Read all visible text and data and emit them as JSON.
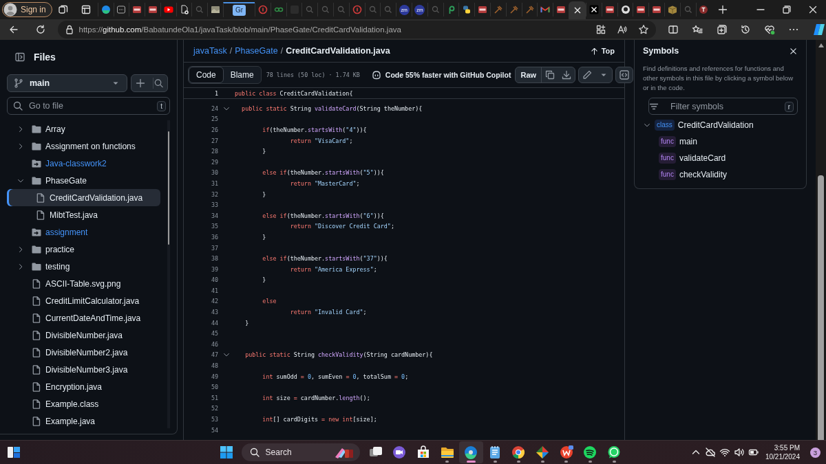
{
  "browser": {
    "profile": {
      "label": "Sign in"
    },
    "tabs": [
      {
        "kind": "edge",
        "selected": false
      },
      {
        "kind": "window",
        "selected": false
      },
      {
        "kind": "pdf",
        "selected": false
      },
      {
        "kind": "pdf",
        "selected": false
      },
      {
        "kind": "youtube",
        "selected": false
      },
      {
        "kind": "file",
        "selected": false
      },
      {
        "kind": "search",
        "selected": false
      },
      {
        "kind": "image",
        "selected": false
      },
      {
        "kind": "text",
        "label": "Gr",
        "selected": false
      },
      {
        "kind": "redring",
        "selected": false
      },
      {
        "kind": "gfg",
        "selected": false
      },
      {
        "kind": "dark",
        "selected": false
      },
      {
        "kind": "search",
        "selected": false
      },
      {
        "kind": "search",
        "selected": false
      },
      {
        "kind": "search",
        "selected": false
      },
      {
        "kind": "redring",
        "selected": false
      },
      {
        "kind": "search",
        "selected": false
      },
      {
        "kind": "search",
        "selected": false
      },
      {
        "kind": "zoom",
        "label": "zm",
        "selected": false
      },
      {
        "kind": "zoom",
        "label": "zm",
        "selected": false
      },
      {
        "kind": "search",
        "selected": false
      },
      {
        "kind": "p",
        "selected": false
      },
      {
        "kind": "python",
        "selected": false
      },
      {
        "kind": "pdf",
        "selected": false
      },
      {
        "kind": "pen",
        "selected": false
      },
      {
        "kind": "pen",
        "selected": false
      },
      {
        "kind": "pen",
        "selected": false
      },
      {
        "kind": "gmail",
        "selected": false
      },
      {
        "kind": "pdf",
        "selected": false
      },
      {
        "kind": "blank",
        "selected": true
      },
      {
        "kind": "x",
        "selected": false
      },
      {
        "kind": "pdf",
        "selected": false
      },
      {
        "kind": "github",
        "selected": false
      },
      {
        "kind": "pdf",
        "selected": false
      },
      {
        "kind": "pdf",
        "selected": false
      },
      {
        "kind": "box",
        "selected": false
      },
      {
        "kind": "search",
        "selected": false
      },
      {
        "kind": "redt",
        "selected": false
      }
    ],
    "address": {
      "url": "https://github.com/BabatundeOla1/javaTask/blob/main/PhaseGate/CreditCardValidation.java"
    }
  },
  "sidebar": {
    "title": "Files",
    "branch": "main",
    "search": {
      "placeholder": "Go to file",
      "shortcut": "t"
    },
    "tree": [
      {
        "kind": "folder",
        "name": "Array",
        "expanded": false,
        "selected": false
      },
      {
        "kind": "folder",
        "name": "Assignment on functions",
        "expanded": false,
        "selected": false
      },
      {
        "kind": "submodule",
        "name": "Java-classwork2",
        "selected": false
      },
      {
        "kind": "folder",
        "name": "PhaseGate",
        "expanded": true,
        "selected": false,
        "children": [
          {
            "kind": "file",
            "name": "CreditCardValidation.java",
            "selected": true
          },
          {
            "kind": "file",
            "name": "MibtTest.java",
            "selected": false
          }
        ]
      },
      {
        "kind": "submodule",
        "name": "assignment",
        "selected": false
      },
      {
        "kind": "folder",
        "name": "practice",
        "expanded": false,
        "selected": false
      },
      {
        "kind": "folder",
        "name": "testing",
        "expanded": false,
        "selected": false
      },
      {
        "kind": "file",
        "name": "ASCII-Table.svg.png",
        "selected": false
      },
      {
        "kind": "file",
        "name": "CreditLimitCalculator.java",
        "selected": false
      },
      {
        "kind": "file",
        "name": "CurrentDateAndTime.java",
        "selected": false
      },
      {
        "kind": "file",
        "name": "DivisibleNumber.java",
        "selected": false
      },
      {
        "kind": "file",
        "name": "DivisibleNumber2.java",
        "selected": false
      },
      {
        "kind": "file",
        "name": "DivisibleNumber3.java",
        "selected": false
      },
      {
        "kind": "file",
        "name": "Encryption.java",
        "selected": false
      },
      {
        "kind": "file",
        "name": "Example.class",
        "selected": false
      },
      {
        "kind": "file",
        "name": "Example.java",
        "selected": false
      }
    ]
  },
  "file_header": {
    "breadcrumb": [
      {
        "kind": "link",
        "text": "javaTask"
      },
      {
        "kind": "separator",
        "text": "/"
      },
      {
        "kind": "link",
        "text": "PhaseGate"
      },
      {
        "kind": "separator",
        "text": "/"
      },
      {
        "kind": "current",
        "text": "CreditCardValidation.java"
      }
    ],
    "top": "Top"
  },
  "toolbar": {
    "tabs": [
      {
        "label": "Code",
        "selected": true
      },
      {
        "label": "Blame",
        "selected": false
      }
    ],
    "info": "78 lines (50 loc) · 1.74 KB",
    "promo": "Code 55% faster with GitHub Copilot",
    "raw": "Raw"
  },
  "code": {
    "sticky": {
      "number": "1",
      "tokens": [
        {
          "kind": "kw",
          "text": "public class "
        },
        {
          "kind": "p",
          "text": "CreditCardValidation{"
        }
      ]
    },
    "lines": [
      {
        "number": "24",
        "foldable": true,
        "tokens": [
          {
            "kind": "kw",
            "text": "  public static "
          },
          {
            "kind": "p",
            "text": "String "
          },
          {
            "kind": "fn",
            "text": "validateCard"
          },
          {
            "kind": "p",
            "text": "(String theNumber){"
          }
        ]
      },
      {
        "number": "25",
        "foldable": false
      },
      {
        "number": "26",
        "foldable": false,
        "tokens": [
          {
            "kind": "kw",
            "text": "        if"
          },
          {
            "kind": "p",
            "text": "(theNumber."
          },
          {
            "kind": "fn",
            "text": "startsWith"
          },
          {
            "kind": "p",
            "text": "("
          },
          {
            "kind": "str",
            "text": "\"4\""
          },
          {
            "kind": "p",
            "text": ")){"
          }
        ]
      },
      {
        "number": "27",
        "foldable": false,
        "tokens": [
          {
            "kind": "kw",
            "text": "                return "
          },
          {
            "kind": "str",
            "text": "\"VisaCard\""
          },
          {
            "kind": "p",
            "text": ";"
          }
        ]
      },
      {
        "number": "28",
        "foldable": false,
        "tokens": [
          {
            "kind": "p",
            "text": "        }"
          }
        ]
      },
      {
        "number": "29",
        "foldable": false
      },
      {
        "number": "30",
        "foldable": false,
        "tokens": [
          {
            "kind": "kw",
            "text": "        else if"
          },
          {
            "kind": "p",
            "text": "(theNumber."
          },
          {
            "kind": "fn",
            "text": "startsWith"
          },
          {
            "kind": "p",
            "text": "("
          },
          {
            "kind": "str",
            "text": "\"5\""
          },
          {
            "kind": "p",
            "text": ")){"
          }
        ]
      },
      {
        "number": "31",
        "foldable": false,
        "tokens": [
          {
            "kind": "kw",
            "text": "                return "
          },
          {
            "kind": "str",
            "text": "\"MasterCard\""
          },
          {
            "kind": "p",
            "text": ";"
          }
        ]
      },
      {
        "number": "32",
        "foldable": false,
        "tokens": [
          {
            "kind": "p",
            "text": "        }"
          }
        ]
      },
      {
        "number": "33",
        "foldable": false
      },
      {
        "number": "34",
        "foldable": false,
        "tokens": [
          {
            "kind": "kw",
            "text": "        else if"
          },
          {
            "kind": "p",
            "text": "(theNumber."
          },
          {
            "kind": "fn",
            "text": "startsWith"
          },
          {
            "kind": "p",
            "text": "("
          },
          {
            "kind": "str",
            "text": "\"6\""
          },
          {
            "kind": "p",
            "text": ")){"
          }
        ]
      },
      {
        "number": "35",
        "foldable": false,
        "tokens": [
          {
            "kind": "kw",
            "text": "                return "
          },
          {
            "kind": "str",
            "text": "\"Discover Credit Card\""
          },
          {
            "kind": "p",
            "text": ";"
          }
        ]
      },
      {
        "number": "36",
        "foldable": false,
        "tokens": [
          {
            "kind": "p",
            "text": "        }"
          }
        ]
      },
      {
        "number": "37",
        "foldable": false
      },
      {
        "number": "38",
        "foldable": false,
        "tokens": [
          {
            "kind": "kw",
            "text": "        else if"
          },
          {
            "kind": "p",
            "text": "(theNumber."
          },
          {
            "kind": "fn",
            "text": "startsWith"
          },
          {
            "kind": "p",
            "text": "("
          },
          {
            "kind": "str",
            "text": "\"37\""
          },
          {
            "kind": "p",
            "text": ")){"
          }
        ]
      },
      {
        "number": "39",
        "foldable": false,
        "tokens": [
          {
            "kind": "kw",
            "text": "                return "
          },
          {
            "kind": "str",
            "text": "\"America Express\""
          },
          {
            "kind": "p",
            "text": ";"
          }
        ]
      },
      {
        "number": "40",
        "foldable": false,
        "tokens": [
          {
            "kind": "p",
            "text": "        }"
          }
        ]
      },
      {
        "number": "41",
        "foldable": false
      },
      {
        "number": "42",
        "foldable": false,
        "tokens": [
          {
            "kind": "kw",
            "text": "        else"
          }
        ]
      },
      {
        "number": "43",
        "foldable": false,
        "tokens": [
          {
            "kind": "kw",
            "text": "                return "
          },
          {
            "kind": "str",
            "text": "\"Invalid Card\""
          },
          {
            "kind": "p",
            "text": ";"
          }
        ]
      },
      {
        "number": "44",
        "foldable": false,
        "tokens": [
          {
            "kind": "p",
            "text": "   }"
          }
        ]
      },
      {
        "number": "45",
        "foldable": false
      },
      {
        "number": "46",
        "foldable": false
      },
      {
        "number": "47",
        "foldable": true,
        "tokens": [
          {
            "kind": "kw",
            "text": "   public static "
          },
          {
            "kind": "p",
            "text": "String "
          },
          {
            "kind": "fn",
            "text": "checkValidity"
          },
          {
            "kind": "p",
            "text": "(String cardNumber){"
          }
        ]
      },
      {
        "number": "48",
        "foldable": false
      },
      {
        "number": "49",
        "foldable": false,
        "tokens": [
          {
            "kind": "kw",
            "text": "        int "
          },
          {
            "kind": "p",
            "text": "sumOdd "
          },
          {
            "kind": "kw",
            "text": "= "
          },
          {
            "kind": "num",
            "text": "0"
          },
          {
            "kind": "p",
            "text": ", sumEven "
          },
          {
            "kind": "kw",
            "text": "= "
          },
          {
            "kind": "num",
            "text": "0"
          },
          {
            "kind": "p",
            "text": ", totalSum "
          },
          {
            "kind": "kw",
            "text": "= "
          },
          {
            "kind": "num",
            "text": "0"
          },
          {
            "kind": "p",
            "text": ";"
          }
        ]
      },
      {
        "number": "50",
        "foldable": false
      },
      {
        "number": "51",
        "foldable": false,
        "tokens": [
          {
            "kind": "kw",
            "text": "        int "
          },
          {
            "kind": "p",
            "text": "size "
          },
          {
            "kind": "kw",
            "text": "="
          },
          {
            "kind": "p",
            "text": " cardNumber."
          },
          {
            "kind": "fn",
            "text": "length"
          },
          {
            "kind": "p",
            "text": "();"
          }
        ]
      },
      {
        "number": "52",
        "foldable": false
      },
      {
        "number": "53",
        "foldable": false,
        "tokens": [
          {
            "kind": "kw",
            "text": "        int"
          },
          {
            "kind": "p",
            "text": "[] cardDigits "
          },
          {
            "kind": "kw",
            "text": "= new int"
          },
          {
            "kind": "p",
            "text": "[size];"
          }
        ]
      },
      {
        "number": "54",
        "foldable": false
      }
    ]
  },
  "symbols": {
    "title": "Symbols",
    "description": "Find definitions and references for functions and other symbols in this file by clicking a symbol below or in the code.",
    "filter": {
      "placeholder": "Filter symbols",
      "shortcut": "r"
    },
    "tree": [
      {
        "kind": "class",
        "tag": "class",
        "name": "CreditCardValidation",
        "expanded": true,
        "children": [
          {
            "kind": "func",
            "tag": "func",
            "name": "main"
          },
          {
            "kind": "func",
            "tag": "func",
            "name": "validateCard"
          },
          {
            "kind": "func",
            "tag": "func",
            "name": "checkValidity"
          }
        ]
      }
    ]
  },
  "taskbar": {
    "search": {
      "placeholder": "Search"
    },
    "apps": [
      {
        "kind": "taskview",
        "running": false,
        "selected": false
      },
      {
        "kind": "meet",
        "running": false,
        "selected": false
      },
      {
        "kind": "store",
        "running": false,
        "selected": false
      },
      {
        "kind": "explorer",
        "running": true,
        "selected": false
      },
      {
        "kind": "edge",
        "running": true,
        "selected": true
      },
      {
        "kind": "notepad",
        "running": true,
        "selected": false
      },
      {
        "kind": "chrome",
        "running": true,
        "selected": false
      },
      {
        "kind": "pinwheel",
        "running": true,
        "selected": false
      },
      {
        "kind": "wps",
        "running": true,
        "selected": false
      },
      {
        "kind": "spotify",
        "running": true,
        "selected": false
      },
      {
        "kind": "whatsapp",
        "running": true,
        "selected": false
      }
    ],
    "clock": {
      "time": "3:55 PM",
      "date": "10/21/2024"
    },
    "notifications": "3"
  }
}
